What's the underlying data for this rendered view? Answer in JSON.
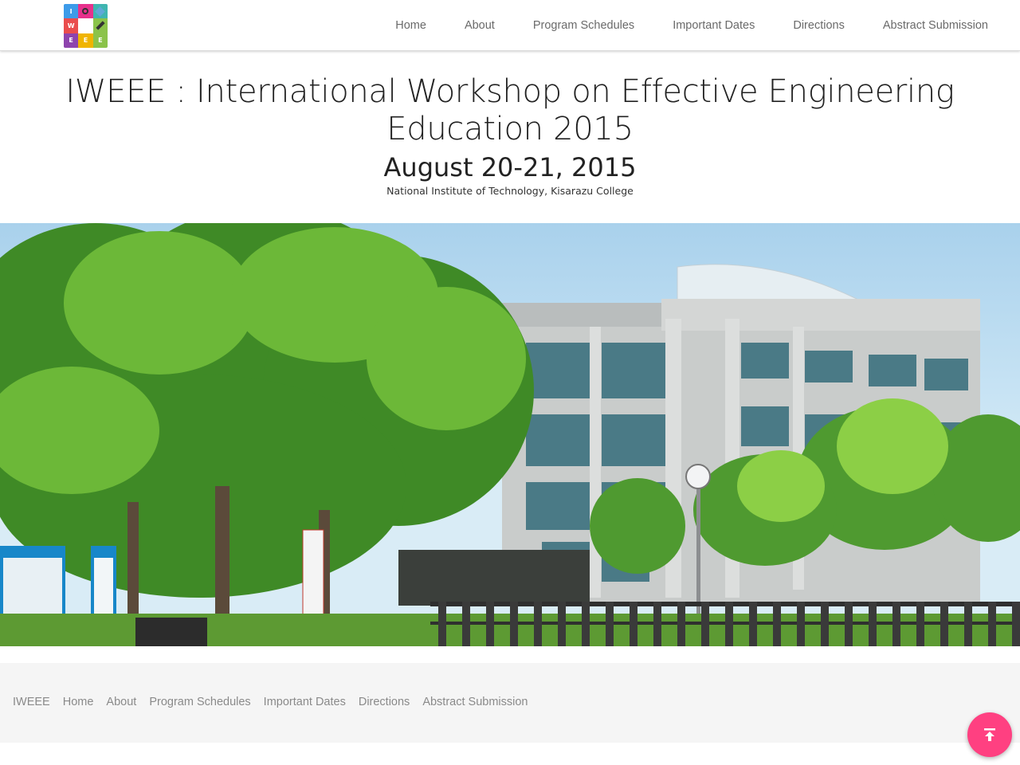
{
  "header": {
    "logo": {
      "letters": [
        "I",
        "",
        "",
        "W",
        "",
        "",
        "E",
        "E",
        "E"
      ],
      "colors": [
        "#3d9be9",
        "#e7318c",
        "#3fb5b0",
        "#ea4d4d",
        "#ffffff",
        "#8bc34a",
        "#8e44ad",
        "#f0b400",
        "#8bc34a"
      ]
    },
    "nav": [
      "Home",
      "About",
      "Program Schedules",
      "Important Dates",
      "Directions",
      "Abstract Submission"
    ]
  },
  "hero": {
    "title": "IWEEE : International Workshop on Effective Engineering Education 2015",
    "date": "August 20-21, 2015",
    "venue": "National Institute of Technology, Kisarazu College"
  },
  "footer": {
    "nav": [
      "IWEEE",
      "Home",
      "About",
      "Program Schedules",
      "Important Dates",
      "Directions",
      "Abstract Submission"
    ]
  },
  "colors": {
    "accent": "#ff4081",
    "text": "#222222",
    "nav_text": "#6a6a6a",
    "footer_bg": "#f5f5f5"
  },
  "icons": {
    "back_to_top": "arrow-up-to-line-icon"
  }
}
